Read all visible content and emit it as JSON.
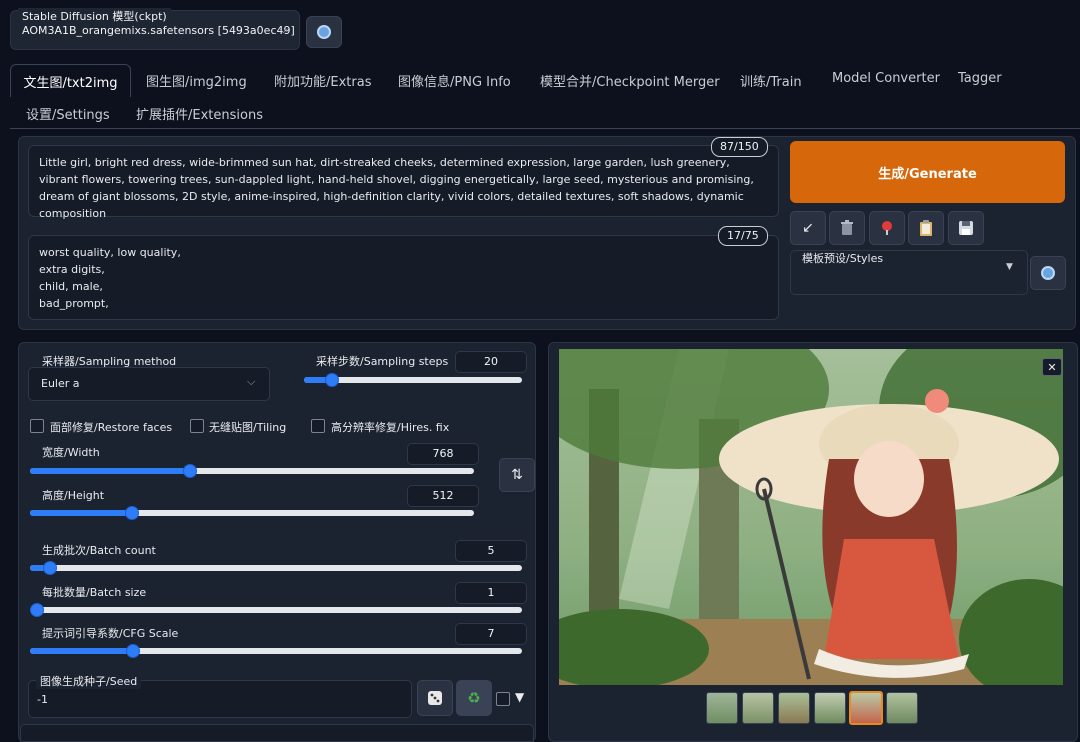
{
  "model": {
    "label": "Stable Diffusion 模型(ckpt)",
    "value": "AOM3A1B_orangemixs.safetensors [5493a0ec49]",
    "refresh_icon": "refresh-icon"
  },
  "tabs": [
    {
      "label": "文生图/txt2img",
      "active": true
    },
    {
      "label": "图生图/img2img"
    },
    {
      "label": "附加功能/Extras"
    },
    {
      "label": "图像信息/PNG Info"
    },
    {
      "label": "模型合并/Checkpoint Merger"
    },
    {
      "label": "训练/Train"
    },
    {
      "label": "Model Converter"
    },
    {
      "label": "Tagger"
    },
    {
      "label": "设置/Settings"
    },
    {
      "label": "扩展插件/Extensions"
    }
  ],
  "prompt": {
    "text": "Little girl, bright red dress, wide-brimmed sun hat, dirt-streaked cheeks, determined expression, large garden, lush greenery, vibrant flowers, towering trees, sun-dappled light, hand-held shovel, digging energetically, large seed, mysterious and promising, dream of giant blossoms, 2D style, anime-inspired, high-definition clarity, vivid colors, detailed textures, soft shadows, dynamic composition",
    "counter": "87/150"
  },
  "negative_prompt": {
    "text": "worst quality, low quality,\nextra digits,\nchild, male,\nbad_prompt,",
    "counter": "17/75"
  },
  "generate_label": "生成/Generate",
  "tool_icons": [
    "arrow-down-left-icon",
    "trash-icon",
    "red-dot-icon",
    "clipboard-icon",
    "save-icon"
  ],
  "styles_label": "模板预设/Styles",
  "sampling": {
    "method_label": "采样器/Sampling method",
    "method_value": "Euler a",
    "steps_label": "采样步数/Sampling steps",
    "steps_value": "20",
    "steps_fraction": 0.13
  },
  "checkboxes": {
    "restore_faces": "面部修复/Restore faces",
    "tiling": "无缝贴图/Tiling",
    "hires_fix": "高分辨率修复/Hires. fix"
  },
  "width": {
    "label": "宽度/Width",
    "value": "768",
    "fraction": 0.36
  },
  "height": {
    "label": "高度/Height",
    "value": "512",
    "fraction": 0.23
  },
  "batch_count": {
    "label": "生成批次/Batch count",
    "value": "5",
    "fraction": 0.04
  },
  "batch_size": {
    "label": "每批数量/Batch size",
    "value": "1",
    "fraction": 0.0
  },
  "cfg_scale": {
    "label": "提示词引导系数/CFG Scale",
    "value": "7",
    "fraction": 0.21
  },
  "seed": {
    "label": "图像生成种子/Seed",
    "value": "-1"
  },
  "seed_icons": [
    "dice-icon",
    "recycle-icon"
  ],
  "extra_toggle": "▼",
  "gallery": {
    "close_glyph": "✕",
    "thumbnail_count": 6,
    "selected_index": 4
  },
  "colors": {
    "generate": "#d7670b",
    "slider": "#2e7cf6",
    "selected_thumb": "#e88a1f"
  }
}
